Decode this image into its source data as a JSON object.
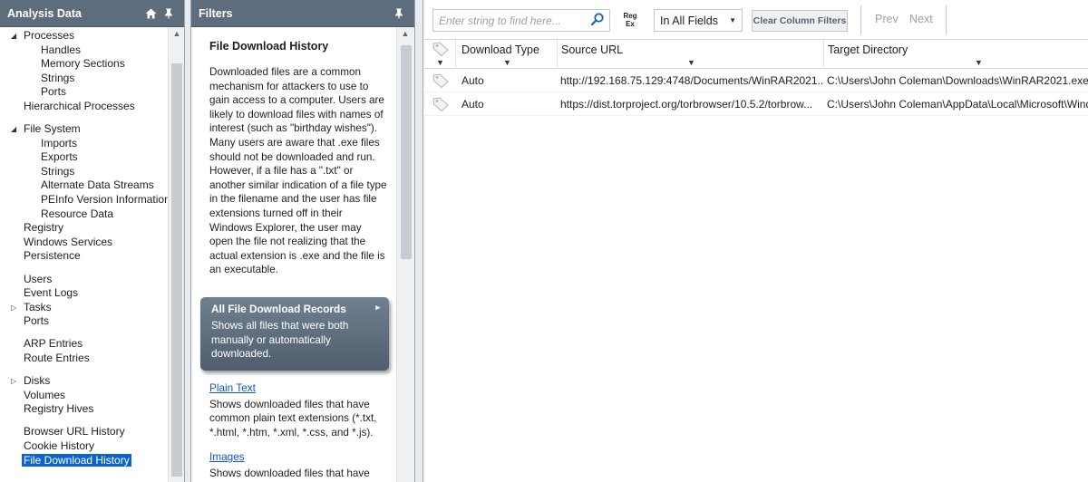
{
  "left_panel": {
    "title": "Analysis Data",
    "tree": [
      {
        "label": "Processes",
        "level": 0,
        "arrow": "expanded"
      },
      {
        "label": "Handles",
        "level": 1
      },
      {
        "label": "Memory Sections",
        "level": 1
      },
      {
        "label": "Strings",
        "level": 1
      },
      {
        "label": "Ports",
        "level": 1
      },
      {
        "label": "Hierarchical Processes",
        "level": 0
      },
      {
        "gap": true
      },
      {
        "label": "File System",
        "level": 0,
        "arrow": "expanded"
      },
      {
        "label": "Imports",
        "level": 1
      },
      {
        "label": "Exports",
        "level": 1
      },
      {
        "label": "Strings",
        "level": 1
      },
      {
        "label": "Alternate Data Streams",
        "level": 1
      },
      {
        "label": "PEInfo Version Information",
        "level": 1
      },
      {
        "label": "Resource Data",
        "level": 1
      },
      {
        "label": "Registry",
        "level": 0
      },
      {
        "label": "Windows Services",
        "level": 0
      },
      {
        "label": "Persistence",
        "level": 0
      },
      {
        "gap": true
      },
      {
        "label": "Users",
        "level": 0
      },
      {
        "label": "Event Logs",
        "level": 0
      },
      {
        "label": "Tasks",
        "level": 0,
        "arrow": "collapsed"
      },
      {
        "label": "Ports",
        "level": 0
      },
      {
        "gap": true
      },
      {
        "label": "ARP Entries",
        "level": 0
      },
      {
        "label": "Route Entries",
        "level": 0
      },
      {
        "gap": true
      },
      {
        "label": "Disks",
        "level": 0,
        "arrow": "collapsed"
      },
      {
        "label": "Volumes",
        "level": 0
      },
      {
        "label": "Registry Hives",
        "level": 0
      },
      {
        "gap": true
      },
      {
        "label": "Browser URL History",
        "level": 0
      },
      {
        "label": "Cookie History",
        "level": 0
      },
      {
        "label": "File Download History",
        "level": 0,
        "selected": true
      }
    ]
  },
  "filters_panel": {
    "title": "Filters",
    "heading": "File Download History",
    "description": "Downloaded files are a common mechanism for attackers to use to gain access to a computer. Users are likely to download files with names of interest (such as \"birthday wishes\"). Many users are aware that .exe files should not be downloaded and run. However, if a file has a \".txt\" or another similar indication of a file type in the filename and the user has file extensions turned off in their Windows Explorer, the user may open the file not realizing that the actual extension is .exe and the file is an executable.",
    "card": {
      "title": "All File Download Records",
      "description": "Shows all files that were both manually or automatically downloaded."
    },
    "links": [
      {
        "label": "Plain Text",
        "description": "Shows downloaded files that have common plain text extensions (*.txt, *.html, *.htm, *.xml, *.css, and *.js)."
      },
      {
        "label": "Images",
        "description": "Shows downloaded files that have"
      }
    ]
  },
  "toolbar": {
    "search_placeholder": "Enter string to find here...",
    "regex_top": "Reg",
    "regex_bottom": "Ex",
    "field_select": "In All Fields",
    "clear_filters": "Clear Column Filters",
    "prev": "Prev",
    "next": "Next"
  },
  "grid": {
    "columns": [
      "Download Type",
      "Source URL",
      "Target Directory"
    ],
    "rows": [
      [
        "Auto",
        "http://192.168.75.129:4748/Documents/WinRAR2021....",
        "C:\\Users\\John Coleman\\Downloads\\WinRAR2021.exe"
      ],
      [
        "Auto",
        "https://dist.torproject.org/torbrowser/10.5.2/torbrow...",
        "C:\\Users\\John Coleman\\AppData\\Local\\Microsoft\\Windo"
      ]
    ]
  }
}
